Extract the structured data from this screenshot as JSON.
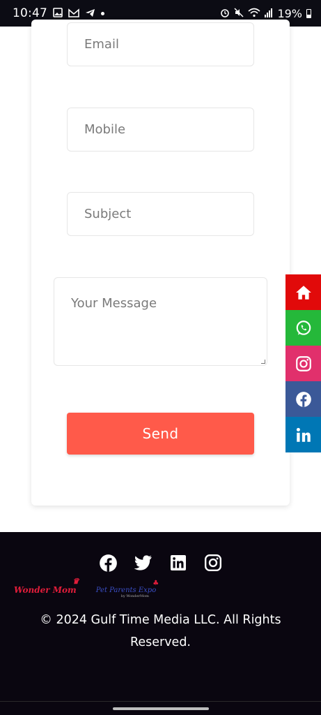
{
  "status_bar": {
    "time": "10:47",
    "battery": "19%"
  },
  "form": {
    "email_placeholder": "Email",
    "mobile_placeholder": "Mobile",
    "subject_placeholder": "Subject",
    "message_placeholder": "Your Message",
    "send_label": "Send"
  },
  "floating_social": [
    {
      "icon": "home-icon",
      "color": "#e10a0a"
    },
    {
      "icon": "whatsapp-icon",
      "color": "#25b83a"
    },
    {
      "icon": "instagram-icon",
      "color": "#e1306c"
    },
    {
      "icon": "facebook-icon",
      "color": "#3b5998"
    },
    {
      "icon": "linkedin-icon",
      "color": "#0077b5"
    }
  ],
  "footer": {
    "social_icons": [
      "facebook-icon",
      "twitter-icon",
      "linkedin-icon",
      "instagram-icon"
    ],
    "logos": {
      "wonder_mom": "Wonder Mom",
      "pet_parents": "Pet Parents Expo",
      "pet_parents_sub": "by WonderMom"
    },
    "copyright_line1": "© 2024 Gulf Time Media LLC. All Rights",
    "copyright_line2": "Reserved."
  },
  "colors": {
    "send_button": "#ff5a4a",
    "footer_bg": "#0a0610"
  }
}
